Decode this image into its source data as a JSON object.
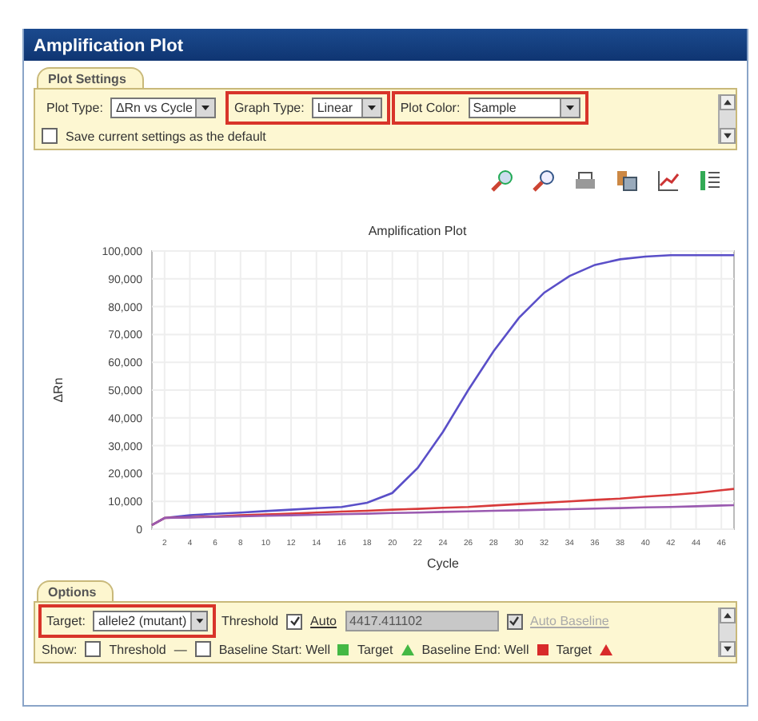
{
  "window": {
    "title": "Amplification Plot"
  },
  "plot_settings": {
    "tab": "Plot Settings",
    "fields": [
      {
        "label": "Plot Type:",
        "value": "ΔRn vs Cycle",
        "highlighted": false
      },
      {
        "label": "Graph Type:",
        "value": "Linear",
        "highlighted": true
      },
      {
        "label": "Plot Color:",
        "value": "Sample",
        "highlighted": true
      }
    ],
    "save_default": {
      "label": "Save current settings as the default",
      "checked": false
    }
  },
  "toolbar": [
    {
      "kind": "zoom-in"
    },
    {
      "kind": "zoom-out"
    },
    {
      "kind": "print"
    },
    {
      "kind": "export"
    },
    {
      "kind": "chart"
    },
    {
      "kind": "legend"
    }
  ],
  "chart": {
    "chart_data": {
      "type": "line",
      "title": "Amplification Plot",
      "xlabel": "Cycle",
      "ylabel": "ΔRn",
      "grid": true,
      "x": [
        1,
        2,
        4,
        6,
        8,
        10,
        12,
        14,
        16,
        18,
        20,
        22,
        24,
        26,
        28,
        30,
        32,
        34,
        36,
        38,
        40,
        42,
        44,
        46,
        47
      ],
      "series": [
        {
          "color": "#5a4fc8",
          "values": [
            1500,
            4000,
            5000,
            5500,
            6000,
            6500,
            7000,
            7500,
            8000,
            9500,
            13000,
            22000,
            35000,
            50000,
            64000,
            76000,
            85000,
            91000,
            95000,
            97000,
            98000,
            98500,
            98500,
            98500,
            98500
          ]
        },
        {
          "color": "#d83a3a",
          "values": [
            1500,
            4000,
            4300,
            4600,
            5000,
            5300,
            5600,
            6000,
            6300,
            6600,
            7000,
            7300,
            7700,
            8000,
            8500,
            9000,
            9500,
            10000,
            10500,
            11000,
            11700,
            12300,
            13000,
            14000,
            14500
          ]
        },
        {
          "color": "#9a5ab0",
          "values": [
            1500,
            4000,
            4200,
            4400,
            4600,
            4800,
            5000,
            5200,
            5400,
            5600,
            5800,
            6000,
            6200,
            6400,
            6600,
            6800,
            7000,
            7200,
            7400,
            7600,
            7800,
            8000,
            8200,
            8500,
            8600
          ]
        }
      ],
      "xlim": [
        1,
        47
      ],
      "ylim": [
        0,
        100000
      ],
      "xticks": [
        2,
        4,
        6,
        8,
        10,
        12,
        14,
        16,
        18,
        20,
        22,
        24,
        26,
        28,
        30,
        32,
        34,
        36,
        38,
        40,
        42,
        44,
        46
      ],
      "yticks": [
        {
          "value": 0,
          "label": "0"
        },
        {
          "value": 10000,
          "label": "10,000"
        },
        {
          "value": 20000,
          "label": "20,000"
        },
        {
          "value": 30000,
          "label": "30,000"
        },
        {
          "value": 40000,
          "label": "40,000"
        },
        {
          "value": 50000,
          "label": "50,000"
        },
        {
          "value": 60000,
          "label": "60,000"
        },
        {
          "value": 70000,
          "label": "70,000"
        },
        {
          "value": 80000,
          "label": "80,000"
        },
        {
          "value": 90000,
          "label": "90,000"
        },
        {
          "value": 100000,
          "label": "100,000"
        }
      ]
    }
  },
  "options": {
    "tab": "Options",
    "target": {
      "label": "Target:",
      "value": "allele2 (mutant)",
      "highlighted": true
    },
    "threshold": {
      "label": "Threshold",
      "auto": {
        "label": "Auto",
        "checked": true
      },
      "value": "4417.411102",
      "disabled": true
    },
    "auto_baseline": {
      "label": "Auto Baseline",
      "checked": true,
      "disabled": true
    },
    "show": {
      "label": "Show:",
      "items": [
        {
          "kind": "checkbox",
          "checked": false,
          "label": "Threshold"
        },
        {
          "kind": "text",
          "label": "—"
        },
        {
          "kind": "checkbox",
          "checked": false,
          "label": "Baseline Start: Well"
        },
        {
          "kind": "square",
          "color": "#44b844"
        },
        {
          "kind": "text",
          "label": "Target"
        },
        {
          "kind": "triangle",
          "color": "#44b844"
        },
        {
          "kind": "text",
          "label": "Baseline End: Well"
        },
        {
          "kind": "square",
          "color": "#d82a2a"
        },
        {
          "kind": "text",
          "label": "Target"
        },
        {
          "kind": "triangle",
          "color": "#d82a2a"
        }
      ]
    }
  }
}
